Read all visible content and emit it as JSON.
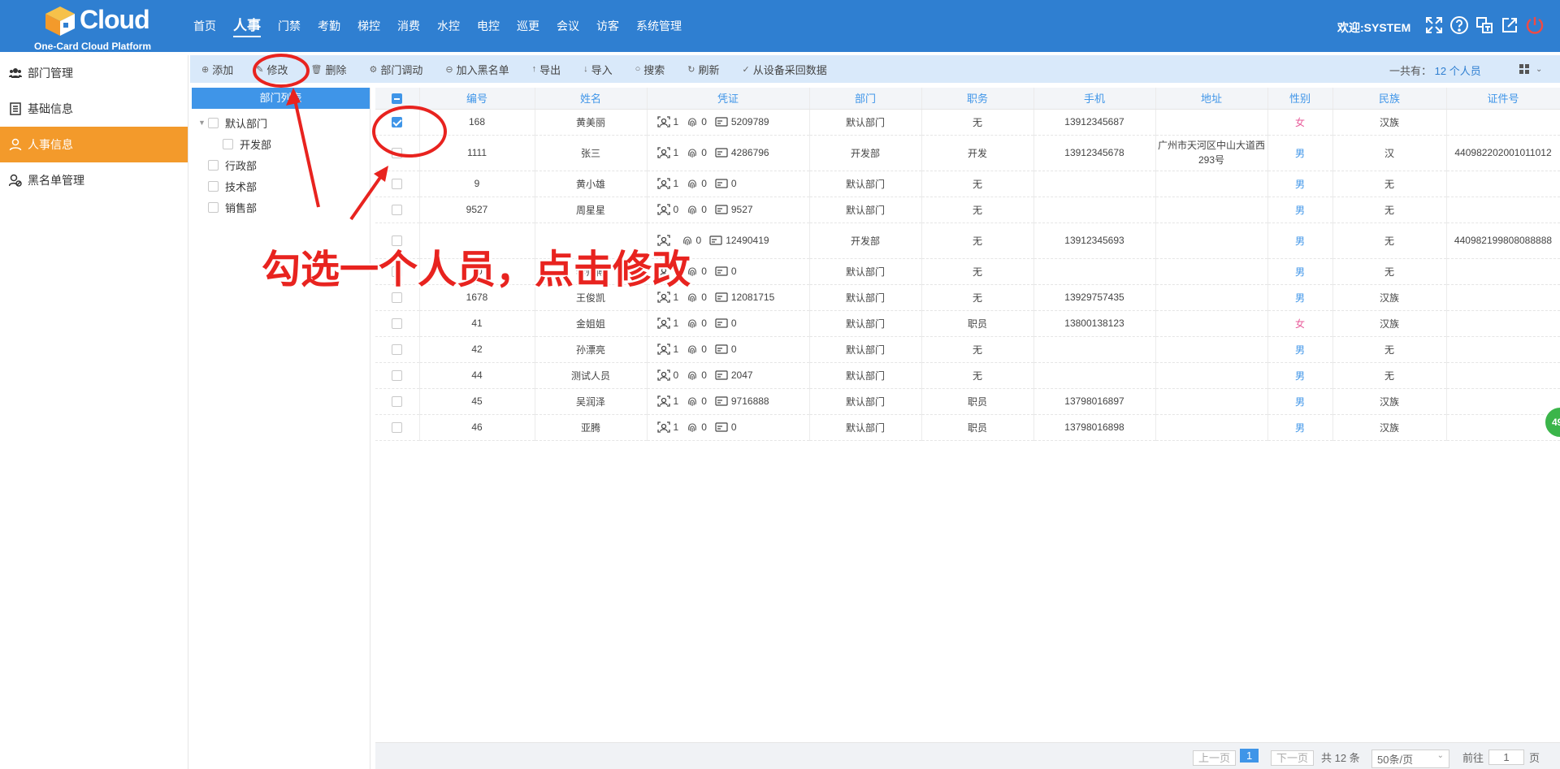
{
  "header": {
    "brand": "Cloud",
    "subtitle": "One-Card Cloud Platform",
    "nav": [
      "首页",
      "人事",
      "门禁",
      "考勤",
      "梯控",
      "消费",
      "水控",
      "电控",
      "巡更",
      "会议",
      "访客",
      "系统管理"
    ],
    "active_nav": "人事",
    "welcome": "欢迎:SYSTEM",
    "icons": [
      "fullscreen-icon",
      "help-icon",
      "language-icon",
      "edit-external-icon",
      "power-icon"
    ]
  },
  "sidebar": {
    "items": [
      {
        "label": "部门管理",
        "icon": "team-icon"
      },
      {
        "label": "基础信息",
        "icon": "list-icon"
      },
      {
        "label": "人事信息",
        "icon": "user-icon",
        "active": true
      },
      {
        "label": "黑名单管理",
        "icon": "user-block-icon"
      }
    ]
  },
  "toolbar": {
    "buttons": [
      "添加",
      "修改",
      "删除",
      "部门调动",
      "加入黑名单",
      "导出",
      "导入",
      "搜索",
      "刷新",
      "从设备采回数据"
    ],
    "total_label": "一共有：",
    "total_value": "12 个人员"
  },
  "dept": {
    "title": "部门列表",
    "tree": [
      {
        "label": "默认部门",
        "level": 0,
        "expanded": true
      },
      {
        "label": "开发部",
        "level": 1
      },
      {
        "label": "行政部",
        "level": 0
      },
      {
        "label": "技术部",
        "level": 0
      },
      {
        "label": "销售部",
        "level": 0
      }
    ]
  },
  "table": {
    "columns": [
      "编号",
      "姓名",
      "凭证",
      "部门",
      "职务",
      "手机",
      "地址",
      "性别",
      "民族",
      "证件号"
    ],
    "rows": [
      {
        "id": "168",
        "name": "黄美丽",
        "face": "1",
        "finger": "0",
        "card": "5209789",
        "dept": "默认部门",
        "title": "无",
        "phone": "13912345687",
        "addr": "",
        "gender": "女",
        "ethnic": "汉族",
        "idno": "",
        "checked": true
      },
      {
        "id": "1111",
        "name": "张三",
        "face": "1",
        "finger": "0",
        "card": "4286796",
        "dept": "开发部",
        "title": "开发",
        "phone": "13912345678",
        "addr": "广州市天河区中山大道西293号",
        "gender": "男",
        "ethnic": "汉",
        "idno": "440982202001011012",
        "tall": true
      },
      {
        "id": "9",
        "name": "黄小雄",
        "face": "1",
        "finger": "0",
        "card": "0",
        "dept": "默认部门",
        "title": "无",
        "phone": "",
        "addr": "",
        "gender": "男",
        "ethnic": "无",
        "idno": ""
      },
      {
        "id": "9527",
        "name": "周星星",
        "face": "0",
        "finger": "0",
        "card": "9527",
        "dept": "默认部门",
        "title": "无",
        "phone": "",
        "addr": "",
        "gender": "男",
        "ethnic": "无",
        "idno": ""
      },
      {
        "id": "",
        "name": "",
        "face": "",
        "finger": "0",
        "card": "12490419",
        "dept": "开发部",
        "title": "无",
        "phone": "13912345693",
        "addr": "",
        "gender": "男",
        "ethnic": "无",
        "idno": "440982199808088888",
        "tall": true
      },
      {
        "id": "10",
        "name": "李师傅",
        "face": "1",
        "finger": "0",
        "card": "0",
        "dept": "默认部门",
        "title": "无",
        "phone": "",
        "addr": "",
        "gender": "男",
        "ethnic": "无",
        "idno": ""
      },
      {
        "id": "1678",
        "name": "王俊凯",
        "face": "1",
        "finger": "0",
        "card": "12081715",
        "dept": "默认部门",
        "title": "无",
        "phone": "13929757435",
        "addr": "",
        "gender": "男",
        "ethnic": "汉族",
        "idno": ""
      },
      {
        "id": "41",
        "name": "金姐姐",
        "face": "1",
        "finger": "0",
        "card": "0",
        "dept": "默认部门",
        "title": "职员",
        "phone": "13800138123",
        "addr": "",
        "gender": "女",
        "ethnic": "汉族",
        "idno": ""
      },
      {
        "id": "42",
        "name": "孙漂亮",
        "face": "1",
        "finger": "0",
        "card": "0",
        "dept": "默认部门",
        "title": "无",
        "phone": "",
        "addr": "",
        "gender": "男",
        "ethnic": "无",
        "idno": ""
      },
      {
        "id": "44",
        "name": "测试人员",
        "face": "0",
        "finger": "0",
        "card": "2047",
        "dept": "默认部门",
        "title": "无",
        "phone": "",
        "addr": "",
        "gender": "男",
        "ethnic": "无",
        "idno": ""
      },
      {
        "id": "45",
        "name": "吴润泽",
        "face": "1",
        "finger": "0",
        "card": "9716888",
        "dept": "默认部门",
        "title": "职员",
        "phone": "13798016897",
        "addr": "",
        "gender": "男",
        "ethnic": "汉族",
        "idno": ""
      },
      {
        "id": "46",
        "name": "亚腾",
        "face": "1",
        "finger": "0",
        "card": "0",
        "dept": "默认部门",
        "title": "职员",
        "phone": "13798016898",
        "addr": "",
        "gender": "男",
        "ethnic": "汉族",
        "idno": ""
      }
    ]
  },
  "pager": {
    "prev": "上一页",
    "current": "1",
    "next": "下一页",
    "total": "共 12 条",
    "page_size": "50条/页",
    "goto_label": "前往",
    "goto_value": "1",
    "page_unit": "页"
  },
  "annotation": {
    "text": "勾选一个人员，点击修改",
    "color": "#e8231f"
  },
  "side_badge": "49"
}
